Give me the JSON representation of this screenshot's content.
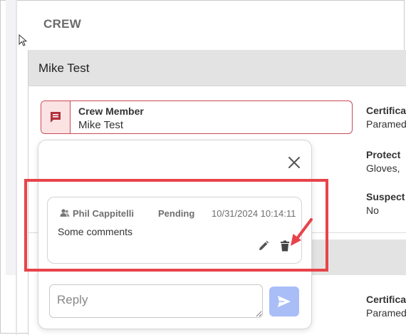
{
  "section": {
    "title": "CREW"
  },
  "card": {
    "title": "Mike Test",
    "crew_field": {
      "label": "Crew Member",
      "value": "Mike Test"
    },
    "right_column": [
      {
        "label": "Certificat",
        "value": "Paramed"
      },
      {
        "label": "Protect",
        "value": "Gloves, "
      },
      {
        "label": "Suspect",
        "value": "No"
      },
      {
        "label": "Certificat",
        "value": "Paramed"
      }
    ]
  },
  "popover": {
    "comment": {
      "author": "Phil Cappitelli",
      "status": "Pending",
      "date": "10/31/2024 10:14:11",
      "text": "Some comments"
    },
    "reply": {
      "placeholder": "Reply"
    }
  },
  "colors": {
    "highlight": "#e8434a",
    "send_button": "#a9bdf7",
    "field_border": "#c94a55",
    "icon_bg": "#fbe3e4"
  },
  "icons": [
    "comment-icon",
    "close-icon",
    "user-icon",
    "edit-icon",
    "delete-icon",
    "send-icon",
    "arrow-annotation"
  ]
}
